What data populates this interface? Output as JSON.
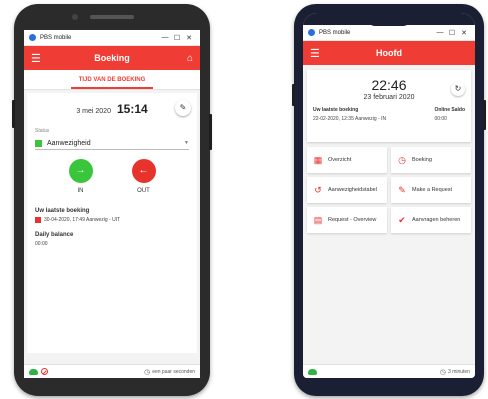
{
  "phone1": {
    "window": {
      "app_name": "PBS mobile",
      "min": "—",
      "max": "☐",
      "close": "✕"
    },
    "appbar": {
      "menu_icon": "☰",
      "title": "Boeking",
      "home_icon": "⌂"
    },
    "tab": {
      "label": "TIJD VAN DE BOEKING"
    },
    "booking": {
      "date": "3 mei 2020",
      "time": "15:14",
      "edit_icon": "✎",
      "status_label": "Status",
      "status_value": "Aanwezigheid",
      "status_color": "#3cc43c",
      "in_label": "IN",
      "out_label": "OUT",
      "in_icon": "→",
      "out_icon": "←"
    },
    "last_booking": {
      "title": "Uw laatste boeking",
      "text": "30-04-2020, 17:49 Aanwezig - UIT"
    },
    "daily_balance": {
      "title": "Daily balance",
      "value": "00:00"
    },
    "status_bar": {
      "sync_text": "een paar seconden"
    }
  },
  "phone2": {
    "window": {
      "app_name": "PBS mobile",
      "min": "—",
      "max": "☐",
      "close": "✕"
    },
    "appbar": {
      "menu_icon": "☰",
      "title": "Hoofd"
    },
    "clock": {
      "time": "22:46",
      "date": "23 februari 2020",
      "refresh_icon": "↻"
    },
    "info": {
      "last_booking_label": "Uw laatste boeking",
      "last_booking_value": "22-02-2020, 12:35 Aanwezig - IN",
      "balance_label": "Online Saldo",
      "balance_value": "00:00"
    },
    "tiles": [
      {
        "label": "Overzicht",
        "icon": "calendar-icon",
        "glyph": "▦"
      },
      {
        "label": "Boeking",
        "icon": "clock-icon",
        "glyph": "◷"
      },
      {
        "label": "Aanwezigheidstabel",
        "icon": "history-icon",
        "glyph": "↺"
      },
      {
        "label": "Make a Request",
        "icon": "pencil-icon",
        "glyph": "✎"
      },
      {
        "label": "Request - Overview",
        "icon": "document-icon",
        "glyph": "▤"
      },
      {
        "label": "Aanvragen beheren",
        "icon": "checkmarks-icon",
        "glyph": "✔"
      }
    ],
    "status_bar": {
      "sync_text": "3 minuten"
    }
  },
  "colors": {
    "accent": "#ef3d35",
    "in": "#39c63a",
    "out": "#e8332d"
  }
}
